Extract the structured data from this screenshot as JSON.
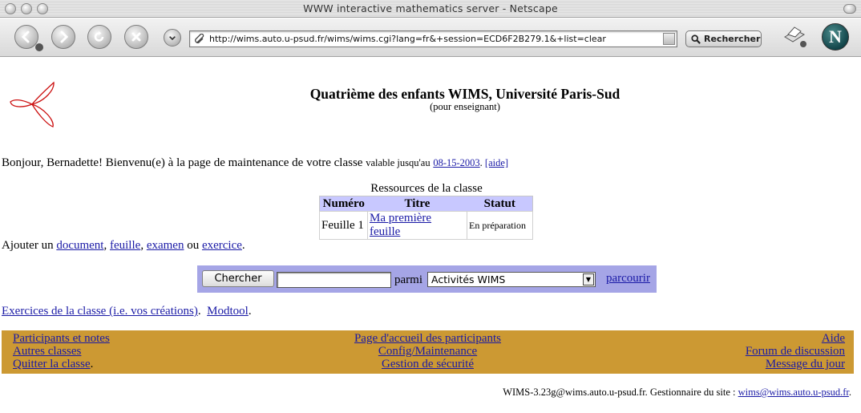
{
  "window": {
    "title": "WWW interactive mathematics server - Netscape"
  },
  "toolbar": {
    "url": "http://wims.auto.u-psud.fr/wims/wims.cgi?lang=fr&+session=ECD6F2B279.1&+list=clear",
    "search_label": "Rechercher",
    "logo_letter": "N"
  },
  "header": {
    "title": "Quatrième des enfants WIMS, Université Paris-Sud",
    "subtitle": "(pour enseignant)"
  },
  "welcome": {
    "text": "Bonjour, Bernadette! Bienvenu(e) à la page de maintenance de votre classe",
    "valid_label": "valable jusqu'au",
    "date": "08-15-2003",
    "period": ".",
    "help": "[aide]"
  },
  "resources": {
    "caption": "Ressources de la classe",
    "columns": [
      "Numéro",
      "Titre",
      "Statut"
    ],
    "rows": [
      {
        "numero": "Feuille 1",
        "titre": "Ma première feuille",
        "statut": "En préparation"
      }
    ]
  },
  "add": {
    "prefix": "Ajouter un",
    "document": "document",
    "feuille": "feuille",
    "examen": "examen",
    "or": "ou",
    "exercice": "exercice",
    "sep": ",",
    "end": "."
  },
  "search": {
    "button": "Chercher",
    "value": "",
    "parmi": "parmi",
    "selected": "Activités WIMS",
    "browse": "parcourir"
  },
  "exercices": {
    "link": "Exercices de la classe (i.e. vos créations)",
    "modtool": "Modtool",
    "end": "."
  },
  "footer_menu": {
    "left": [
      "Participants et notes",
      "Autres classes",
      "Quitter la classe"
    ],
    "left_end": ".",
    "center": [
      "Page d'accueil des participants",
      "Config/Maintenance",
      "Gestion de sécurité"
    ],
    "right": [
      "Aide",
      "Forum de discussion",
      "Message du jour"
    ]
  },
  "site_footer": {
    "text": "WIMS-3.23g@wims.auto.u-psud.fr. Gestionnaire du site :",
    "email": "wims@wims.auto.u-psud.fr",
    "end": "."
  },
  "colors": {
    "table_header": "#c8c8ff",
    "search_bar": "#a5a5e6",
    "footer_menu": "#cc9933",
    "link": "#1a1aa6"
  }
}
